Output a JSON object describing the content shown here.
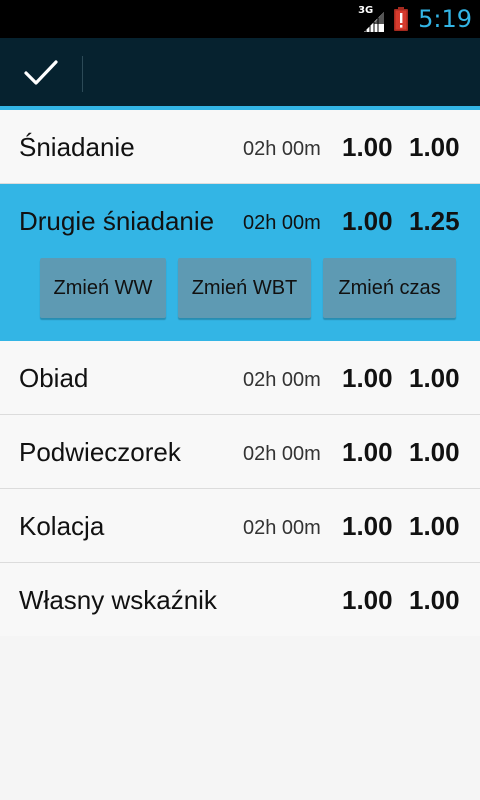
{
  "status_bar": {
    "network": "3G",
    "time": "5:19",
    "battery_alert": "!",
    "colors": {
      "background": "#000000",
      "time": "#33b5e5",
      "battery": "#e33b2f"
    }
  },
  "action_bar": {
    "done_icon": "check-icon",
    "background": "#06222f",
    "accent": "#33b5e5"
  },
  "meals": [
    {
      "name": "Śniadanie",
      "time": "02h 00m",
      "v1": "1.00",
      "v2": "1.00"
    },
    {
      "name": "Drugie śniadanie",
      "time": "02h 00m",
      "v1": "1.00",
      "v2": "1.25"
    },
    {
      "name": "Obiad",
      "time": "02h 00m",
      "v1": "1.00",
      "v2": "1.00"
    },
    {
      "name": "Podwieczorek",
      "time": "02h 00m",
      "v1": "1.00",
      "v2": "1.00"
    },
    {
      "name": "Kolacja",
      "time": "02h 00m",
      "v1": "1.00",
      "v2": "1.00"
    },
    {
      "name": "Własny wskaźnik",
      "time": "",
      "v1": "1.00",
      "v2": "1.00"
    }
  ],
  "selected_meal_actions": {
    "change_ww": "Zmień WW",
    "change_wbt": "Zmień WBT",
    "change_time": "Zmień czas"
  },
  "colors": {
    "selected_row": "#33b5e5",
    "action_button": "#5e9ab3",
    "list_background": "#f8f8f8",
    "divider": "#dcdcdc"
  }
}
